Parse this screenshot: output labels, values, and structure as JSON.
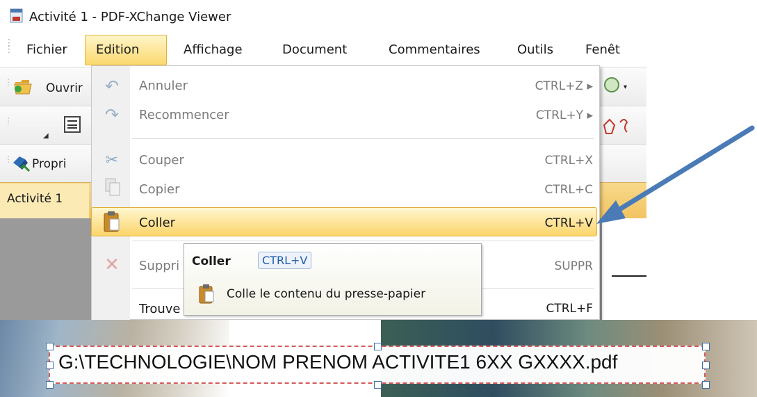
{
  "window": {
    "title": "Activité 1 - PDF-XChange Viewer"
  },
  "menubar": {
    "items": [
      "Fichier",
      "Edition",
      "Affichage",
      "Document",
      "Commentaires",
      "Outils",
      "Fenêt"
    ]
  },
  "toolbars": {
    "open_label": "Ouvrir",
    "properties_label": "Propri"
  },
  "tab": {
    "label": "Activité 1"
  },
  "edit_menu": {
    "items": [
      {
        "label": "Annuler",
        "shortcut": "CTRL+Z ▸",
        "enabled": false,
        "icon": "undo-icon"
      },
      {
        "label": "Recommencer",
        "shortcut": "CTRL+Y ▸",
        "enabled": false,
        "icon": "redo-icon"
      },
      {
        "label": "Couper",
        "shortcut": "CTRL+X",
        "enabled": false,
        "icon": "scissors-icon"
      },
      {
        "label": "Copier",
        "shortcut": "CTRL+C",
        "enabled": false,
        "icon": "copy-icon"
      },
      {
        "label": "Coller",
        "shortcut": "CTRL+V",
        "enabled": true,
        "highlighted": true,
        "icon": "paste-icon"
      },
      {
        "label": "Suppri",
        "shortcut": "SUPPR",
        "enabled": false,
        "icon": "delete-icon"
      },
      {
        "label": "Trouve",
        "shortcut": "CTRL+F",
        "enabled": true,
        "icon": "find-icon"
      }
    ]
  },
  "tooltip": {
    "title": "Coller",
    "shortcut": "CTRL+V",
    "description": "Colle le contenu du presse-papier"
  },
  "document": {
    "filepath": "G:\\TECHNOLOGIE\\NOM PRENOM ACTIVITE1 6XX GXXXX.pdf"
  },
  "colors": {
    "highlight": "#fcd56a",
    "arrow": "#4a7bb7",
    "selection_border": "#d35b5b"
  }
}
